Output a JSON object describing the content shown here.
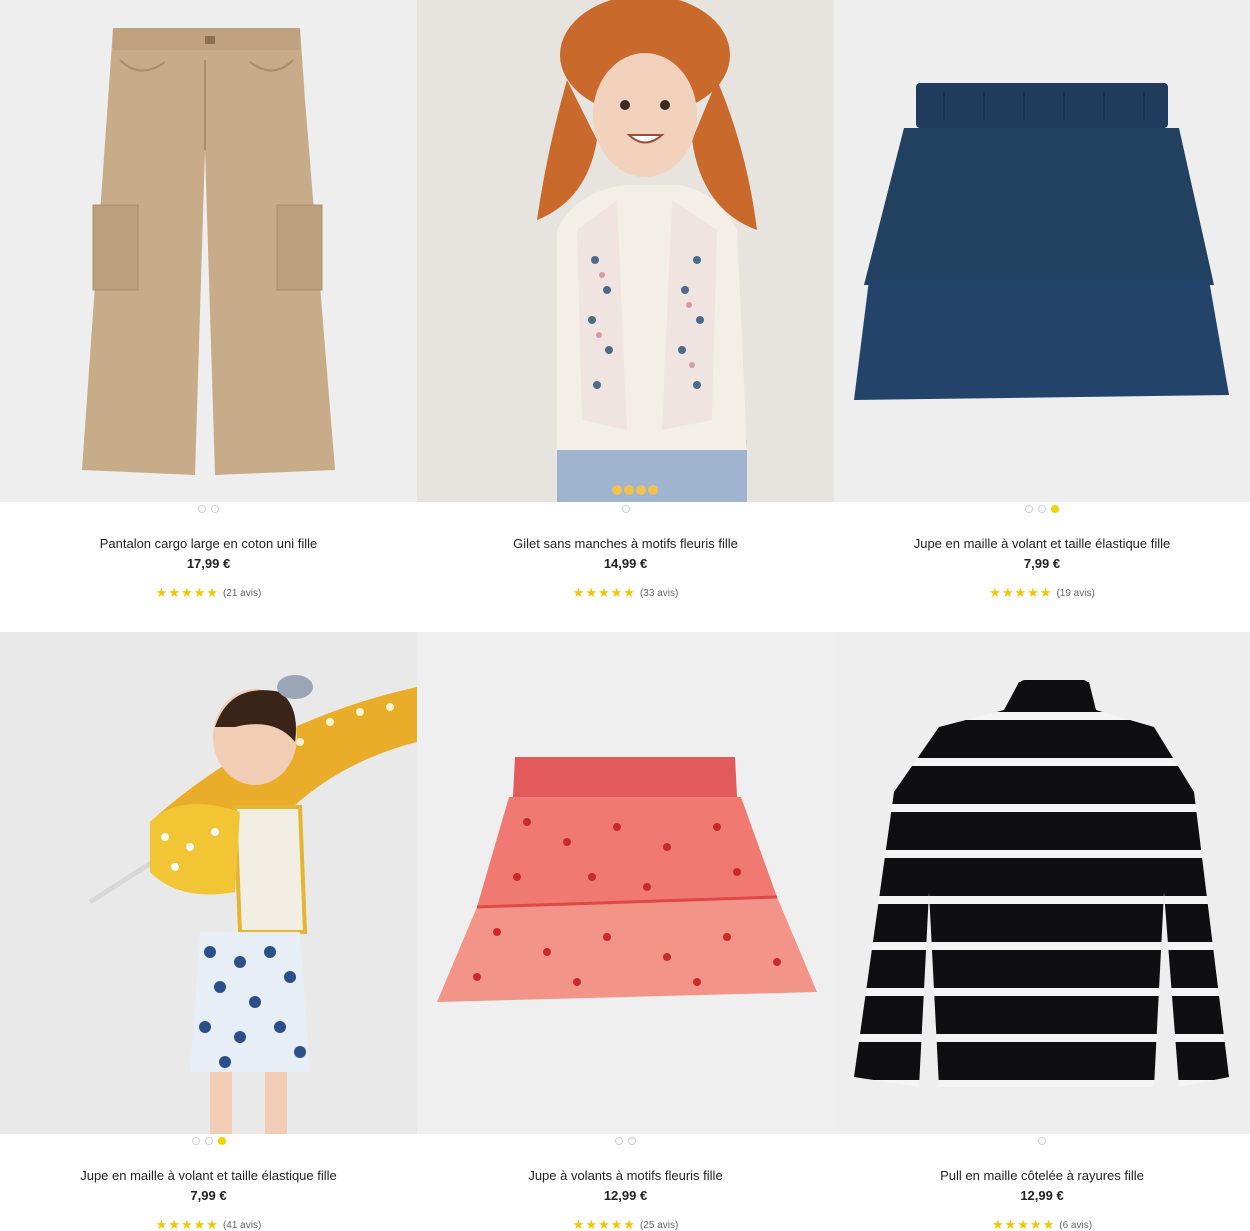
{
  "products": [
    {
      "name": "Pantalon cargo large en coton uni fille",
      "price": "17,99 €",
      "stars": "★★★★★",
      "reviews": "(21 avis)",
      "image_bg": "#eeeeee",
      "carousel": {
        "total": 2,
        "active": 0
      }
    },
    {
      "name": "Gilet sans manches à motifs fleuris fille",
      "price": "14,99 €",
      "stars": "★★★★★",
      "reviews": "(33 avis)",
      "image_bg": "#e7e4df",
      "carousel": {
        "total": 1,
        "active": 0
      }
    },
    {
      "name": "Jupe en maille à volant et taille élastique fille",
      "price": "7,99 €",
      "stars": "★★★★★",
      "reviews": "(19 avis)",
      "image_bg": "#eeeeee",
      "carousel": {
        "total": 3,
        "active": 3
      }
    },
    {
      "name": "Jupe en maille à volant et taille élastique fille",
      "price": "7,99 €",
      "stars": "★★★★★",
      "reviews": "(41 avis)",
      "image_bg": "#e9e9e9",
      "carousel": {
        "total": 3,
        "active": 3
      }
    },
    {
      "name": "Jupe à volants à motifs fleuris fille",
      "price": "12,99 €",
      "stars": "★★★★★",
      "reviews": "(25 avis)",
      "image_bg": "#efefef",
      "carousel": {
        "total": 2,
        "active": 0
      }
    },
    {
      "name": "Pull en maille côtelée à rayures fille",
      "price": "12,99 €",
      "stars": "★★★★★",
      "reviews": "(6 avis)",
      "image_bg": "#eeeeee",
      "carousel": {
        "total": 1,
        "active": 0
      }
    }
  ],
  "colors": {
    "star": "#f5c400",
    "dot_active": "#f2d300"
  }
}
